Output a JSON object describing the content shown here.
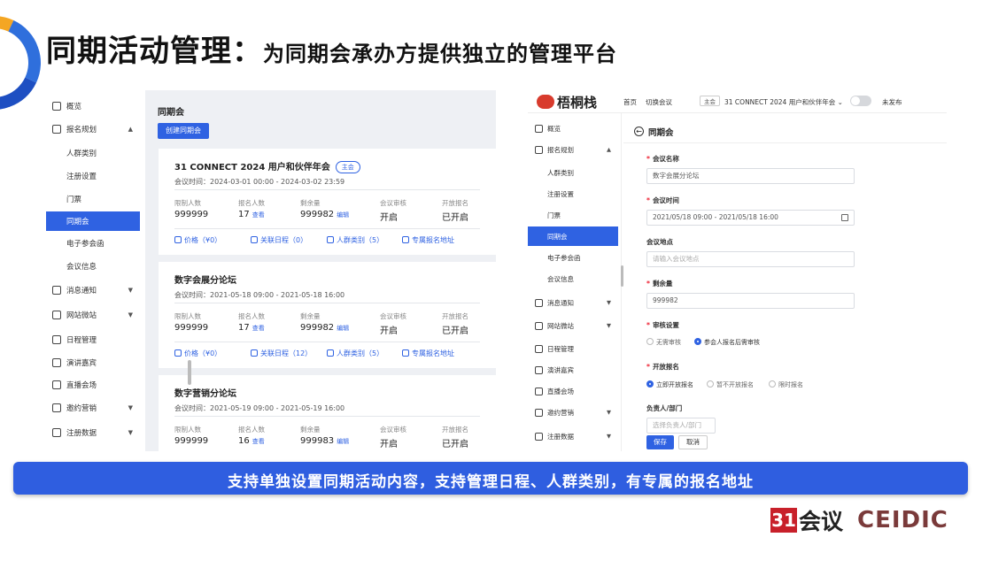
{
  "title": {
    "main": "同期活动管理：",
    "sub": "为同期会承办方提供独立的管理平台"
  },
  "left_panel": {
    "nav": [
      {
        "label": "概览",
        "icon": "overview-icon",
        "arrow": ""
      },
      {
        "label": "报名规划",
        "icon": "registration-icon",
        "arrow": "▲"
      },
      {
        "label": "人群类别",
        "icon": "",
        "arrow": ""
      },
      {
        "label": "注册设置",
        "icon": "",
        "arrow": ""
      },
      {
        "label": "门票",
        "icon": "",
        "arrow": ""
      },
      {
        "label": "同期会",
        "icon": "",
        "arrow": ""
      },
      {
        "label": "电子参会函",
        "icon": "",
        "arrow": ""
      },
      {
        "label": "会议信息",
        "icon": "",
        "arrow": ""
      },
      {
        "label": "消息通知",
        "icon": "bell-icon",
        "arrow": "▼"
      },
      {
        "label": "网站微站",
        "icon": "monitor-icon",
        "arrow": "▼"
      },
      {
        "label": "日程管理",
        "icon": "calendar-icon",
        "arrow": ""
      },
      {
        "label": "演讲嘉宾",
        "icon": "speaker-icon",
        "arrow": ""
      },
      {
        "label": "直播会场",
        "icon": "live-icon",
        "arrow": ""
      },
      {
        "label": "邀约营销",
        "icon": "invite-icon",
        "arrow": "▼"
      },
      {
        "label": "注册数据",
        "icon": "data-icon",
        "arrow": "▼"
      }
    ],
    "heading": "同期会",
    "create_button": "创建同期会",
    "stat_labels": [
      "限制人数",
      "报名人数",
      "剩余量",
      "会议审核",
      "开放报名"
    ],
    "view_link": "查看",
    "edit_link": "编辑",
    "cards": [
      {
        "title": "31 CONNECT 2024 用户和伙伴年会",
        "tag": "主会",
        "time": "会议时间：2024-03-01 00:00 - 2024-03-02 23:59",
        "limit": "999999",
        "registered": "17",
        "remaining": "999982",
        "review": "开启",
        "open": "已开启",
        "price": "价格（¥0）",
        "schedule": "关联日程（0）",
        "groups": "人群类别（5）",
        "address": "专属报名地址"
      },
      {
        "title": "数字会展分论坛",
        "tag": "",
        "time": "会议时间：2021-05-18 09:00 - 2021-05-18 16:00",
        "limit": "999999",
        "registered": "17",
        "remaining": "999982",
        "review": "开启",
        "open": "已开启",
        "price": "价格（¥0）",
        "schedule": "关联日程（12）",
        "groups": "人群类别（5）",
        "address": "专属报名地址"
      },
      {
        "title": "数字营销分论坛",
        "tag": "",
        "time": "会议时间：2021-05-19 09:00 - 2021-05-19 16:00",
        "limit": "999999",
        "registered": "16",
        "remaining": "999983",
        "review": "开启",
        "open": "已开启"
      }
    ]
  },
  "right_panel": {
    "brand": "梧桐栈",
    "topnav": {
      "home": "首页",
      "switch": "切换会议",
      "main_tag": "主会",
      "event": "31 CONNECT 2024 用户和伙伴年会",
      "unpublished": "未发布"
    },
    "nav": [
      {
        "label": "概览",
        "arrow": ""
      },
      {
        "label": "报名规划",
        "arrow": "▲"
      },
      {
        "label": "人群类别",
        "arrow": ""
      },
      {
        "label": "注册设置",
        "arrow": ""
      },
      {
        "label": "门票",
        "arrow": ""
      },
      {
        "label": "同期会",
        "arrow": ""
      },
      {
        "label": "电子参会函",
        "arrow": ""
      },
      {
        "label": "会议信息",
        "arrow": ""
      },
      {
        "label": "消息通知",
        "arrow": "▼"
      },
      {
        "label": "网站微站",
        "arrow": "▼"
      },
      {
        "label": "日程管理",
        "arrow": ""
      },
      {
        "label": "演讲嘉宾",
        "arrow": ""
      },
      {
        "label": "直播会场",
        "arrow": ""
      },
      {
        "label": "邀约营销",
        "arrow": "▼"
      },
      {
        "label": "注册数据",
        "arrow": "▼"
      }
    ],
    "form": {
      "page_title": "同期会",
      "name_label": "会议名称",
      "name_value": "数字会展分论坛",
      "time_label": "会议时间",
      "time_value": "2021/05/18 09:00 - 2021/05/18 16:00",
      "location_label": "会议地点",
      "location_placeholder": "请输入会议地点",
      "remaining_label": "剩余量",
      "remaining_value": "999982",
      "review_label": "审核设置",
      "review_options": [
        "无需审核",
        "参会人报名后需审核"
      ],
      "open_label": "开放报名",
      "open_options": [
        "立即开放报名",
        "暂不开放报名",
        "限时报名"
      ],
      "owner_label": "负责人/部门",
      "owner_placeholder": "选择负责人/部门",
      "save": "保存",
      "cancel": "取消"
    }
  },
  "banner": "支持单独设置同期活动内容，支持管理日程、人群类别，有专属的报名地址",
  "footer": {
    "logo_31": "31",
    "logo_hy": "会议",
    "logo_ceidic": "CEIDIC"
  }
}
